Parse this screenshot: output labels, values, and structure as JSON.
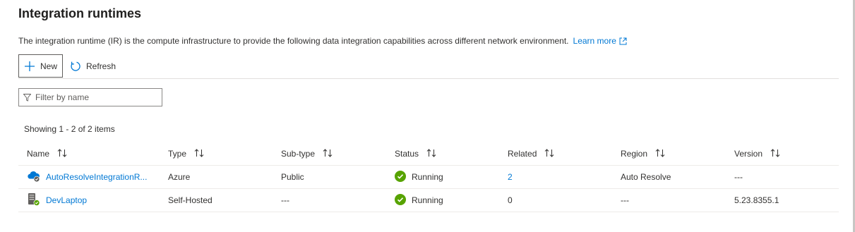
{
  "page": {
    "title": "Integration runtimes",
    "description": "The integration runtime (IR) is the compute infrastructure to provide the following data integration capabilities across different network environment.",
    "learn_more": "Learn more"
  },
  "toolbar": {
    "new_label": "New",
    "refresh_label": "Refresh"
  },
  "filter": {
    "placeholder": "Filter by name",
    "value": ""
  },
  "showing": "Showing 1 - 2 of 2 items",
  "columns": [
    "Name",
    "Type",
    "Sub-type",
    "Status",
    "Related",
    "Region",
    "Version"
  ],
  "rows": [
    {
      "icon": "cloud-ir-icon",
      "name": "AutoResolveIntegrationR...",
      "type": "Azure",
      "subtype": "Public",
      "status": "Running",
      "related": "2",
      "region": "Auto Resolve",
      "version": "---"
    },
    {
      "icon": "self-hosted-ir-icon",
      "name": "DevLaptop",
      "type": "Self-Hosted",
      "subtype": "---",
      "status": "Running",
      "related": "0",
      "region": "---",
      "version": "5.23.8355.1"
    }
  ],
  "colors": {
    "accent": "#0078d4",
    "running": "#107c10",
    "border": "#edebe9"
  }
}
